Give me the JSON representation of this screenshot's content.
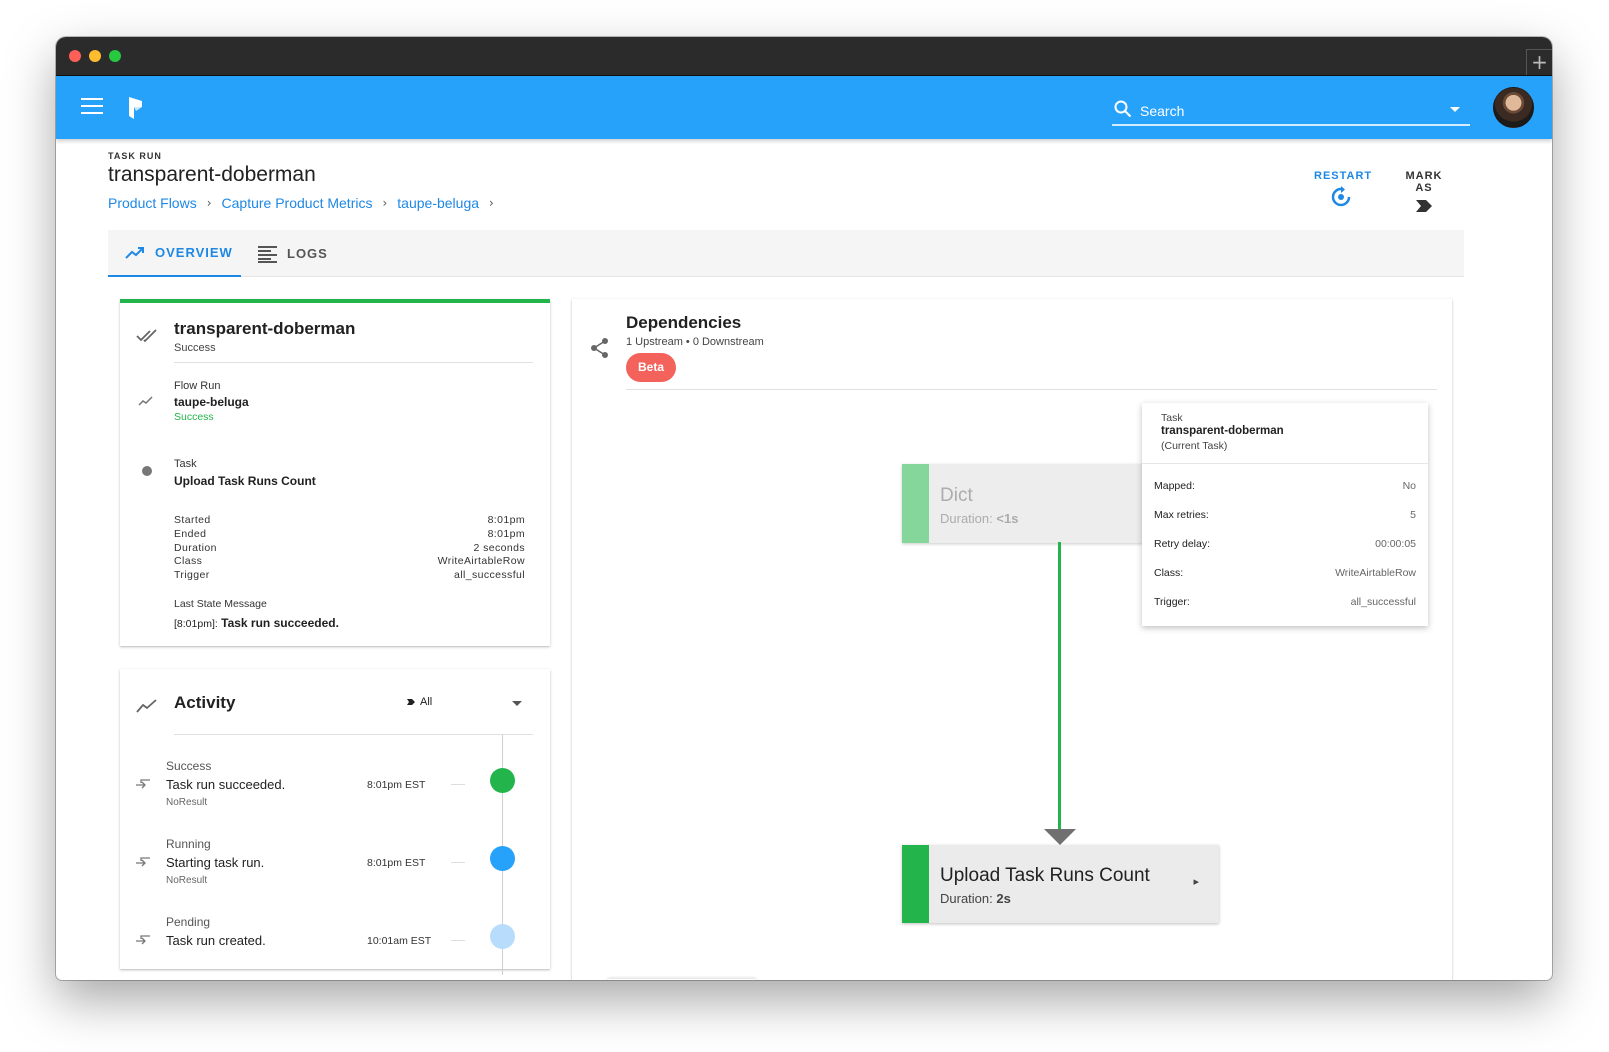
{
  "header": {
    "search_placeholder": "Search"
  },
  "page": {
    "eyebrow": "TASK RUN",
    "title": "transparent-doberman",
    "breadcrumbs": [
      "Product Flows",
      "Capture Product Metrics",
      "taupe-beluga"
    ],
    "actions": {
      "restart": "RESTART",
      "mark_as": "MARK AS"
    }
  },
  "tabs": {
    "overview": "OVERVIEW",
    "logs": "LOGS"
  },
  "details": {
    "name": "transparent-doberman",
    "status": "Success",
    "flow_run": {
      "label": "Flow Run",
      "name": "taupe-beluga",
      "status": "Success"
    },
    "task": {
      "label": "Task",
      "name": "Upload Task Runs Count"
    },
    "fields": [
      {
        "k": "Started",
        "v": "8:01pm"
      },
      {
        "k": "Ended",
        "v": "8:01pm"
      },
      {
        "k": "Duration",
        "v": "2 seconds"
      },
      {
        "k": "Class",
        "v": "WriteAirtableRow"
      },
      {
        "k": "Trigger",
        "v": "all_successful"
      }
    ],
    "last_state_label": "Last State Message",
    "last_state_time": "[8:01pm]:",
    "last_state_msg": "Task run succeeded."
  },
  "activity": {
    "title": "Activity",
    "filter": "All",
    "events": [
      {
        "state": "Success",
        "msg": "Task run succeeded.",
        "result": "NoResult",
        "time": "8:01pm EST",
        "color": "#23b54c"
      },
      {
        "state": "Running",
        "msg": "Starting task run.",
        "result": "NoResult",
        "time": "8:01pm EST",
        "color": "#27a2fb"
      },
      {
        "state": "Pending",
        "msg": "Task run created.",
        "result": "",
        "time": "10:01am EST",
        "color": "#b8dcfb"
      }
    ]
  },
  "dependencies": {
    "title": "Dependencies",
    "sub": "1 Upstream • 0 Downstream",
    "badge": "Beta",
    "upstream": {
      "name": "Dict",
      "duration_label": "Duration:",
      "duration": "<1s"
    },
    "current": {
      "name": "Upload Task Runs Count",
      "duration_label": "Duration:",
      "duration": "2s"
    },
    "tooltip": {
      "label": "Task",
      "name": "transparent-doberman",
      "note": "(Current Task)",
      "rows": [
        {
          "k": "Mapped:",
          "v": "No"
        },
        {
          "k": "Max retries:",
          "v": "5"
        },
        {
          "k": "Retry delay:",
          "v": "00:00:05"
        },
        {
          "k": "Class:",
          "v": "WriteAirtableRow"
        },
        {
          "k": "Trigger:",
          "v": "all_successful"
        }
      ]
    }
  },
  "colors": {
    "appbar": "#27a2fb",
    "accent": "#1e88e5",
    "success": "#23b54c",
    "running": "#27a2fb",
    "pending": "#b8dcfb",
    "badge": "#f3635b"
  },
  "icons": [
    "menu-icon",
    "prefect-logo",
    "search-icon",
    "chevron-down-icon",
    "restart-icon",
    "mark-as-icon",
    "trending-up-icon",
    "logs-icon",
    "double-check-icon",
    "dot-icon",
    "swap-icon",
    "share-icon",
    "chevron-right-icon"
  ]
}
